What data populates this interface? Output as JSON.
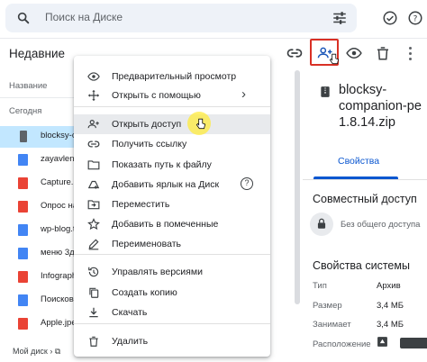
{
  "search": {
    "placeholder": "Поиск на Диске"
  },
  "list": {
    "title": "Недавние",
    "column_header": "Название",
    "section": "Сегодня",
    "files": [
      {
        "name": "blocksy-c",
        "type": "zip",
        "color": "#5f6368"
      },
      {
        "name": "zayavlenie",
        "type": "doc",
        "color": "#4285f4"
      },
      {
        "name": "Capture.P",
        "type": "image",
        "color": "#ea4335"
      },
      {
        "name": "Опрос на",
        "type": "image",
        "color": "#ea4335"
      },
      {
        "name": "wp-blog.t",
        "type": "doc",
        "color": "#4285f4"
      },
      {
        "name": "меню 3д",
        "type": "doc",
        "color": "#4285f4"
      },
      {
        "name": "Infograph",
        "type": "image",
        "color": "#ea4335"
      },
      {
        "name": "Поисков",
        "type": "doc",
        "color": "#4285f4"
      },
      {
        "name": "Apple.jpe",
        "type": "image",
        "color": "#ea4335"
      }
    ],
    "breadcrumb": "Мой диск"
  },
  "menu": {
    "items": [
      {
        "label": "Предварительный просмотр",
        "icon": "eye-icon"
      },
      {
        "label": "Открыть с помощью",
        "icon": "open-with-icon",
        "submenu": true
      },
      {
        "label": "Открыть доступ",
        "icon": "person-add-icon",
        "highlighted": true
      },
      {
        "label": "Получить ссылку",
        "icon": "link-icon"
      },
      {
        "label": "Показать путь к файлу",
        "icon": "folder-icon"
      },
      {
        "label": "Добавить ярлык на Диск",
        "icon": "drive-shortcut-icon"
      },
      {
        "label": "Переместить",
        "icon": "move-icon"
      },
      {
        "label": "Добавить в помеченные",
        "icon": "star-icon"
      },
      {
        "label": "Переименовать",
        "icon": "pencil-icon"
      },
      {
        "label": "Управлять версиями",
        "icon": "history-icon"
      },
      {
        "label": "Создать копию",
        "icon": "copy-icon"
      },
      {
        "label": "Скачать",
        "icon": "download-icon"
      },
      {
        "label": "Удалить",
        "icon": "trash-icon"
      }
    ]
  },
  "details": {
    "file_name_lines": [
      "blocksy-",
      "companion-pe",
      "1.8.14.zip"
    ],
    "tab": "Свойства",
    "sharing_title": "Совместный доступ",
    "sharing_status": "Без общего доступа",
    "system_title": "Свойства системы",
    "props": [
      {
        "key": "Тип",
        "value": "Архив"
      },
      {
        "key": "Размер",
        "value": "3,4 МБ"
      },
      {
        "key": "Занимает",
        "value": "3,4 МБ"
      },
      {
        "key": "Расположение",
        "value": ""
      }
    ]
  },
  "colors": {
    "accent": "#0b57d0",
    "selected_row": "#c2e7ff",
    "highlight_border": "#d93025"
  }
}
